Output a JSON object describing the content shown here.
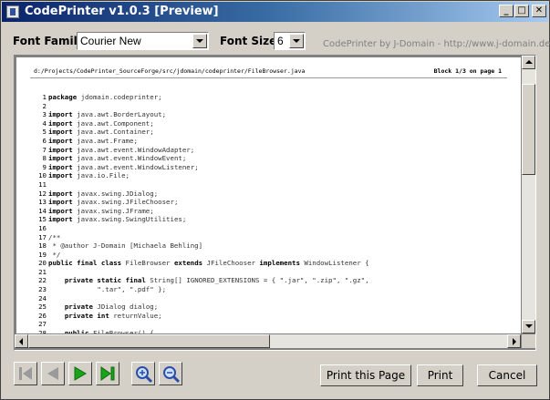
{
  "window": {
    "title": "CodePrinter v1.0.3 [Preview]"
  },
  "controls": {
    "font_family_label": "Font Family:",
    "font_family_value": "Courier New",
    "font_size_label": "Font Size:",
    "font_size_value": "6",
    "credit": "CodePrinter by J-Domain - http://www.j-domain.de"
  },
  "page": {
    "file_path": "d:/Projects/CodePrinter_SourceForge/src/jdomain/codeprinter/FileBrowser.java",
    "block_info": "Block 1/3 on page 1"
  },
  "code_lines": [
    {
      "n": "1",
      "t": "package jdomain.codeprinter;"
    },
    {
      "n": "2",
      "t": ""
    },
    {
      "n": "3",
      "t": "import java.awt.BorderLayout;"
    },
    {
      "n": "4",
      "t": "import java.awt.Component;"
    },
    {
      "n": "5",
      "t": "import java.awt.Container;"
    },
    {
      "n": "6",
      "t": "import java.awt.Frame;"
    },
    {
      "n": "7",
      "t": "import java.awt.event.WindowAdapter;"
    },
    {
      "n": "8",
      "t": "import java.awt.event.WindowEvent;"
    },
    {
      "n": "9",
      "t": "import java.awt.event.WindowListener;"
    },
    {
      "n": "10",
      "t": "import java.io.File;"
    },
    {
      "n": "11",
      "t": ""
    },
    {
      "n": "12",
      "t": "import javax.swing.JDialog;"
    },
    {
      "n": "13",
      "t": "import javax.swing.JFileChooser;"
    },
    {
      "n": "14",
      "t": "import javax.swing.JFrame;"
    },
    {
      "n": "15",
      "t": "import javax.swing.SwingUtilities;"
    },
    {
      "n": "16",
      "t": ""
    },
    {
      "n": "17",
      "t": "/**"
    },
    {
      "n": "18",
      "t": " * @author J-Domain [Michaela Behling]"
    },
    {
      "n": "19",
      "t": " */"
    },
    {
      "n": "20",
      "t": "public final class FileBrowser extends JFileChooser implements WindowListener {"
    },
    {
      "n": "21",
      "t": ""
    },
    {
      "n": "22",
      "t": "    private static final String[] IGNORED_EXTENSIONS = { \".jar\", \".zip\", \".gz\","
    },
    {
      "n": "23",
      "t": "            \".tar\", \".pdf\" };"
    },
    {
      "n": "24",
      "t": ""
    },
    {
      "n": "25",
      "t": "    private JDialog dialog;"
    },
    {
      "n": "26",
      "t": "    private int returnValue;"
    },
    {
      "n": "27",
      "t": ""
    },
    {
      "n": "28",
      "t": "    public FileBrowser() {"
    }
  ],
  "buttons": {
    "print_page": "Print this Page",
    "print": "Print",
    "cancel": "Cancel"
  },
  "colors": {
    "title_start": "#0a246a",
    "title_end": "#a6caf0",
    "nav_green": "#1aa31a",
    "nav_gray": "#9a9a9a",
    "zoom_blue": "#2a4fa8"
  }
}
